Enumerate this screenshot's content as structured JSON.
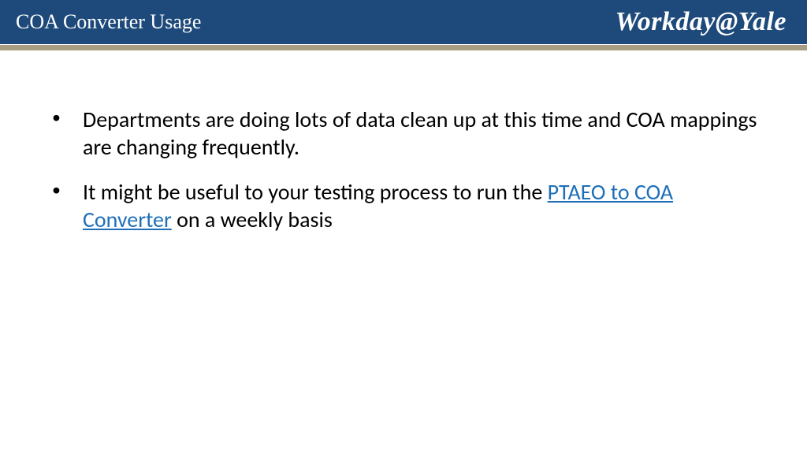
{
  "header": {
    "title": "COA Converter Usage",
    "brand": "Workday@Yale"
  },
  "content": {
    "bullets": [
      {
        "text_before": "Departments are doing lots of data clean up at this time and COA mappings are changing frequently.",
        "link_text": "",
        "text_after": ""
      },
      {
        "text_before": "It might be useful to your testing process to run the ",
        "link_text": "PTAEO to COA Converter",
        "text_after": " on a weekly basis"
      }
    ]
  },
  "colors": {
    "header_bg": "#1d4a7a",
    "underline": "#a89d82",
    "link": "#1f6fb8"
  }
}
